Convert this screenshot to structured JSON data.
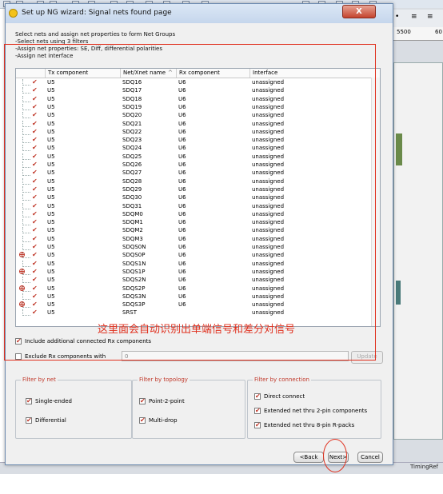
{
  "window": {
    "title": "Set up NG wizard: Signal nets found page",
    "close_label": "X"
  },
  "background_app": {
    "ruler_label": "5500",
    "ruler_label_partial": "60",
    "status_right": "TimingRef"
  },
  "instructions": [
    "Select nets and assign net properties to form Net Groups",
    "-Select nets using 3 filters",
    "-Assign net properties: SE, Diff, differential polarities",
    "-Assign net interface"
  ],
  "table": {
    "columns": [
      "Tx component",
      "Net/Xnet name",
      "Rx component",
      "Interface"
    ],
    "rows": [
      {
        "tx": "U5",
        "net": "SDQ16",
        "rx": "U6",
        "iface": "unassigned",
        "exp": false
      },
      {
        "tx": "U5",
        "net": "SDQ17",
        "rx": "U6",
        "iface": "unassigned",
        "exp": false
      },
      {
        "tx": "U5",
        "net": "SDQ18",
        "rx": "U6",
        "iface": "unassigned",
        "exp": false
      },
      {
        "tx": "U5",
        "net": "SDQ19",
        "rx": "U6",
        "iface": "unassigned",
        "exp": false
      },
      {
        "tx": "U5",
        "net": "SDQ20",
        "rx": "U6",
        "iface": "unassigned",
        "exp": false
      },
      {
        "tx": "U5",
        "net": "SDQ21",
        "rx": "U6",
        "iface": "unassigned",
        "exp": false
      },
      {
        "tx": "U5",
        "net": "SDQ22",
        "rx": "U6",
        "iface": "unassigned",
        "exp": false
      },
      {
        "tx": "U5",
        "net": "SDQ23",
        "rx": "U6",
        "iface": "unassigned",
        "exp": false
      },
      {
        "tx": "U5",
        "net": "SDQ24",
        "rx": "U6",
        "iface": "unassigned",
        "exp": false
      },
      {
        "tx": "U5",
        "net": "SDQ25",
        "rx": "U6",
        "iface": "unassigned",
        "exp": false
      },
      {
        "tx": "U5",
        "net": "SDQ26",
        "rx": "U6",
        "iface": "unassigned",
        "exp": false
      },
      {
        "tx": "U5",
        "net": "SDQ27",
        "rx": "U6",
        "iface": "unassigned",
        "exp": false
      },
      {
        "tx": "U5",
        "net": "SDQ28",
        "rx": "U6",
        "iface": "unassigned",
        "exp": false
      },
      {
        "tx": "U5",
        "net": "SDQ29",
        "rx": "U6",
        "iface": "unassigned",
        "exp": false
      },
      {
        "tx": "U5",
        "net": "SDQ30",
        "rx": "U6",
        "iface": "unassigned",
        "exp": false
      },
      {
        "tx": "U5",
        "net": "SDQ31",
        "rx": "U6",
        "iface": "unassigned",
        "exp": false
      },
      {
        "tx": "U5",
        "net": "SDQM0",
        "rx": "U6",
        "iface": "unassigned",
        "exp": false
      },
      {
        "tx": "U5",
        "net": "SDQM1",
        "rx": "U6",
        "iface": "unassigned",
        "exp": false
      },
      {
        "tx": "U5",
        "net": "SDQM2",
        "rx": "U6",
        "iface": "unassigned",
        "exp": false
      },
      {
        "tx": "U5",
        "net": "SDQM3",
        "rx": "U6",
        "iface": "unassigned",
        "exp": false
      },
      {
        "tx": "U5",
        "net": "SDQS0N",
        "rx": "U6",
        "iface": "unassigned",
        "exp": false
      },
      {
        "tx": "U5",
        "net": "SDQS0P",
        "rx": "U6",
        "iface": "unassigned",
        "exp": true
      },
      {
        "tx": "U5",
        "net": "SDQS1N",
        "rx": "U6",
        "iface": "unassigned",
        "exp": false
      },
      {
        "tx": "U5",
        "net": "SDQS1P",
        "rx": "U6",
        "iface": "unassigned",
        "exp": true
      },
      {
        "tx": "U5",
        "net": "SDQS2N",
        "rx": "U6",
        "iface": "unassigned",
        "exp": false
      },
      {
        "tx": "U5",
        "net": "SDQS2P",
        "rx": "U6",
        "iface": "unassigned",
        "exp": true
      },
      {
        "tx": "U5",
        "net": "SDQS3N",
        "rx": "U6",
        "iface": "unassigned",
        "exp": false
      },
      {
        "tx": "U5",
        "net": "SDQS3P",
        "rx": "U6",
        "iface": "unassigned",
        "exp": true
      },
      {
        "tx": "U5",
        "net": "SRST",
        "rx": "",
        "iface": "unassigned",
        "exp": false
      }
    ]
  },
  "annotation_red_note": "这里面会自动识别出单端信号和差分对信号",
  "include_rx_label": "Include additional connected Rx components",
  "exclude_rx_label": "Exclude Rx components with",
  "exclude_rx_value": "0",
  "update_label": "Update",
  "filter_by_net": {
    "title": "Filter by net",
    "options": [
      "Single-ended",
      "Differential"
    ]
  },
  "filter_by_topology": {
    "title": "Filter by topology",
    "options": [
      "Point-2-point",
      "Multi-drop"
    ]
  },
  "filter_by_connection": {
    "title": "Filter by connection",
    "options": [
      "Direct connect",
      "Extended net thru 2-pin components",
      "Extended net thru 8-pin R-packs"
    ]
  },
  "buttons": {
    "back": "<Back",
    "next": "Next>",
    "cancel": "Cancel"
  },
  "colors": {
    "accent_red": "#e0301e",
    "check_red": "#c0392b"
  }
}
